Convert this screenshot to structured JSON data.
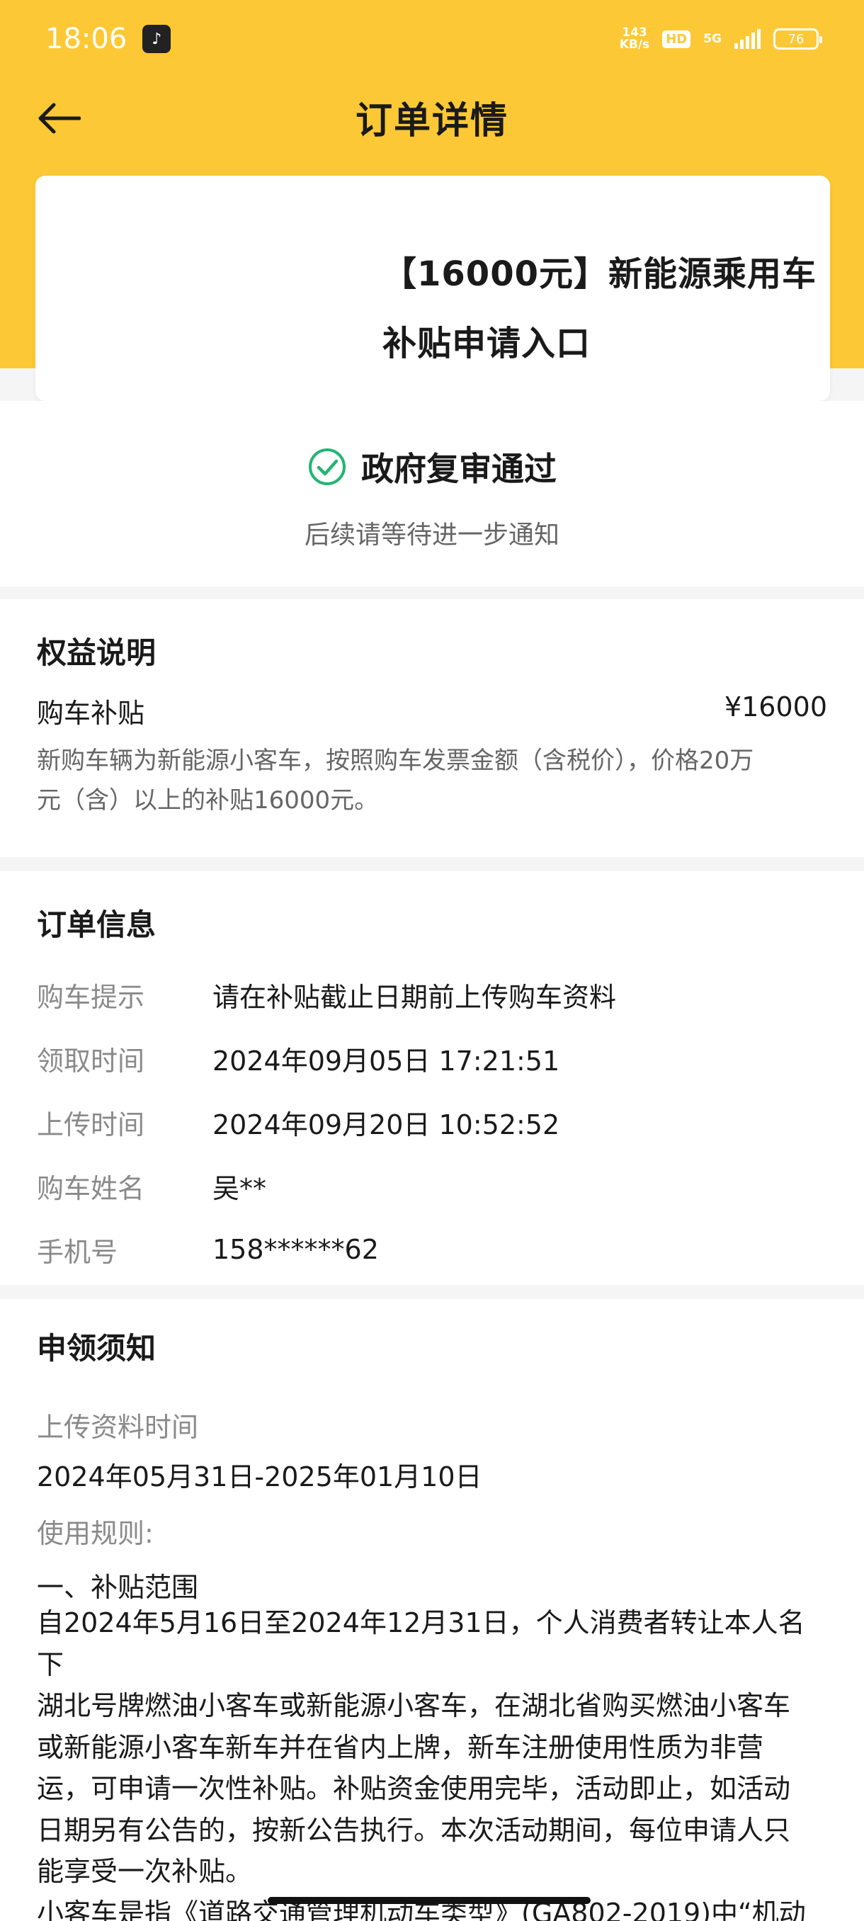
{
  "status_bar": {
    "time": "18:06",
    "net_speed_value": "143",
    "net_speed_unit": "KB/s",
    "hd": "HD",
    "network": "5G",
    "battery": "76"
  },
  "nav": {
    "title": "订单详情",
    "back_icon": "arrow-left-icon"
  },
  "product": {
    "title_line1": "【16000元】新能源乘用车",
    "title_line2": "补贴申请入口"
  },
  "status": {
    "text": "政府复审通过",
    "sub": "后续请等待进一步通知",
    "icon_color": "#22b573"
  },
  "benefit": {
    "title": "权益说明",
    "name": "购车补贴",
    "price": "¥16000",
    "desc_line1": "新购车辆为新能源小客车，按照购车发票金额（含税价），价格20万",
    "desc_line2": "元（含）以上的补贴16000元。"
  },
  "order": {
    "title": "订单信息",
    "rows": [
      {
        "label": "购车提示",
        "value": "请在补贴截止日期前上传购车资料"
      },
      {
        "label": "领取时间",
        "value": "2024年09月05日 17:21:51"
      },
      {
        "label": "上传时间",
        "value": "2024年09月20日 10:52:52"
      },
      {
        "label": "购车姓名",
        "value": "吴**"
      },
      {
        "label": "手机号",
        "value": "158******62"
      }
    ]
  },
  "notice": {
    "title": "申领须知",
    "upload_label": "上传资料时间",
    "upload_value": "2024年05月31日-2025年01月10日",
    "rules_label": "使用规则:",
    "rules_heading": "一、补贴范围",
    "rules_lines": [
      "自2024年5月16日至2024年12月31日，个人消费者转让本人名下",
      "湖北号牌燃油小客车或新能源小客车，在湖北省购买燃油小客车",
      "或新能源小客车新车并在省内上牌，新车注册使用性质为非营",
      "运，可申请一次性补贴。补贴资金使用完毕，活动即止，如活动",
      "日期另有公告的，按新公告执行。本次活动期间，每位申请人只",
      "能享受一次补贴。",
      "小客车是指《道路交通管理机动车类型》(GA802-2019)中“机动"
    ]
  },
  "colors": {
    "brand_yellow": "#fdc835",
    "success_green": "#22b573"
  }
}
